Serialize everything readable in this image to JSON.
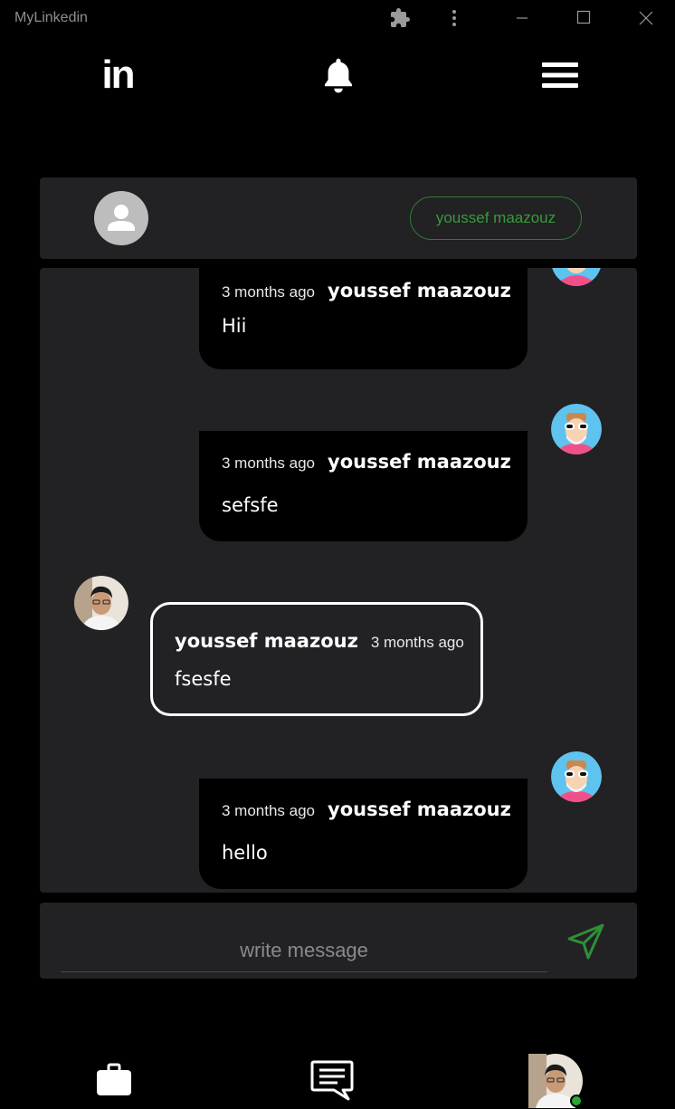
{
  "window": {
    "title": "MyLinkedin"
  },
  "topnav": {
    "logo": "in",
    "icons": [
      "linkedin-logo",
      "bell-icon",
      "menu-icon"
    ]
  },
  "chat_header": {
    "contact_name": "youssef maazouz"
  },
  "messages": [
    {
      "direction": "outgoing",
      "time": "3 months ago",
      "author": "youssef maazouz",
      "text": "Hii"
    },
    {
      "direction": "outgoing",
      "time": "3 months ago",
      "author": "youssef maazouz",
      "text": "sefsfe"
    },
    {
      "direction": "incoming",
      "time": "3 months ago",
      "author": "youssef maazouz",
      "text": "fsesfe"
    },
    {
      "direction": "outgoing",
      "time": "3 months ago",
      "author": "youssef maazouz",
      "text": "hello"
    }
  ],
  "composer": {
    "placeholder": "write message",
    "value": ""
  },
  "bottomnav": {
    "icons": [
      "briefcase-icon",
      "chat-icon",
      "profile-avatar"
    ],
    "online": true
  },
  "colors": {
    "background": "#000000",
    "panel": "#222124",
    "accent_green": "#2f7d32",
    "online_green": "#2aa836"
  }
}
